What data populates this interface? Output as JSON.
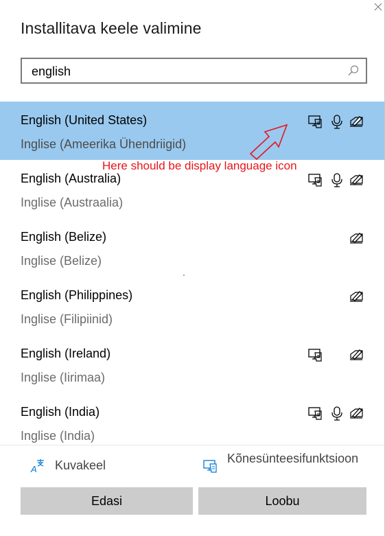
{
  "dialog": {
    "title": "Installitava keele valimine"
  },
  "search": {
    "value": "english",
    "placeholder": ""
  },
  "languages": [
    {
      "name": "English (United States)",
      "native": "Inglise (Ameerika Ühendriigid)",
      "selected": true,
      "features": [
        "display-language-icon",
        "speech-icon",
        "handwriting-icon"
      ]
    },
    {
      "name": "English (Australia)",
      "native": "Inglise (Austraalia)",
      "selected": false,
      "features": [
        "display-language-icon",
        "speech-icon",
        "handwriting-icon"
      ]
    },
    {
      "name": "English (Belize)",
      "native": "Inglise (Belize)",
      "selected": false,
      "features": [
        "handwriting-icon"
      ]
    },
    {
      "name": "English (Philippines)",
      "native": "Inglise (Filipiinid)",
      "selected": false,
      "features": [
        "handwriting-icon"
      ]
    },
    {
      "name": "English (Ireland)",
      "native": "Inglise (Iirimaa)",
      "selected": false,
      "features": [
        "display-language-icon",
        "handwriting-icon"
      ]
    },
    {
      "name": "English (India)",
      "native": "Inglise (India)",
      "selected": false,
      "features": [
        "display-language-icon",
        "speech-icon",
        "handwriting-icon"
      ]
    }
  ],
  "annotation": {
    "text": "Here should be display language icon",
    "color": "#e8141b"
  },
  "legend": {
    "item1": "Kuvakeel",
    "item2": "Kõnesünteesifunktsioon"
  },
  "buttons": {
    "next": "Edasi",
    "cancel": "Loobu"
  },
  "colors": {
    "selected_row": "#99c9ef",
    "accent": "#0078d7",
    "button": "#cccccc"
  }
}
